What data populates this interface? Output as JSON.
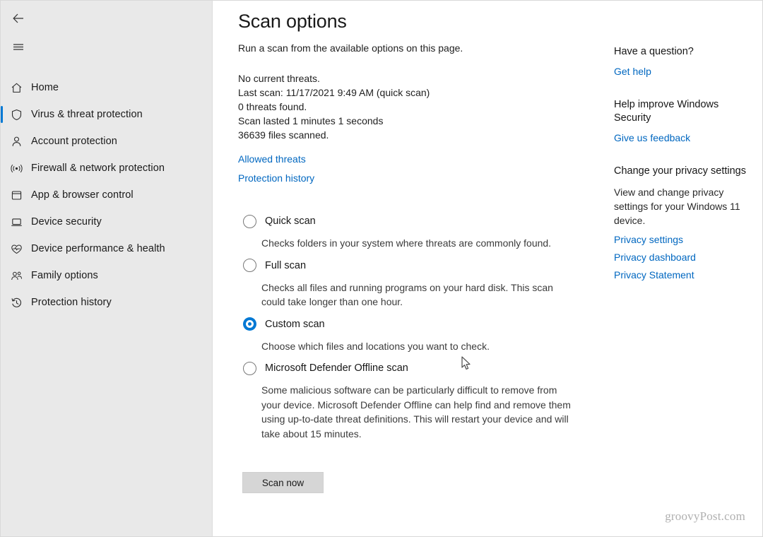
{
  "sidebar": {
    "back_label": "Back",
    "menu_label": "Menu",
    "items": [
      {
        "label": "Home",
        "icon": "home-icon",
        "selected": false
      },
      {
        "label": "Virus & threat protection",
        "icon": "shield-icon",
        "selected": true
      },
      {
        "label": "Account protection",
        "icon": "person-icon",
        "selected": false
      },
      {
        "label": "Firewall & network protection",
        "icon": "wifi-icon",
        "selected": false
      },
      {
        "label": "App & browser control",
        "icon": "app-window-icon",
        "selected": false
      },
      {
        "label": "Device security",
        "icon": "laptop-icon",
        "selected": false
      },
      {
        "label": "Device performance & health",
        "icon": "heart-pulse-icon",
        "selected": false
      },
      {
        "label": "Family options",
        "icon": "people-icon",
        "selected": false
      },
      {
        "label": "Protection history",
        "icon": "history-clock-icon",
        "selected": false
      }
    ]
  },
  "main": {
    "title": "Scan options",
    "subtitle": "Run a scan from the available options on this page.",
    "status_lines": [
      "No current threats.",
      "Last scan: 11/17/2021 9:49 AM (quick scan)",
      "0 threats found.",
      "Scan lasted 1 minutes 1 seconds",
      "36639 files scanned."
    ],
    "status_links": [
      {
        "label": "Allowed threats"
      },
      {
        "label": "Protection history"
      }
    ],
    "options": [
      {
        "label": "Quick scan",
        "selected": false,
        "description": "Checks folders in your system where threats are commonly found."
      },
      {
        "label": "Full scan",
        "selected": false,
        "description": "Checks all files and running programs on your hard disk. This scan could take longer than one hour."
      },
      {
        "label": "Custom scan",
        "selected": true,
        "description": "Choose which files and locations you want to check."
      },
      {
        "label": "Microsoft Defender Offline scan",
        "selected": false,
        "description": "Some malicious software can be particularly difficult to remove from your device. Microsoft Defender Offline can help find and remove them using up-to-date threat definitions. This will restart your device and will take about 15 minutes."
      }
    ],
    "scan_button": "Scan now"
  },
  "right_panel": {
    "sections": [
      {
        "heading": "Have a question?",
        "text": "",
        "links": [
          {
            "label": "Get help"
          }
        ]
      },
      {
        "heading": "Help improve Windows Security",
        "text": "",
        "links": [
          {
            "label": "Give us feedback"
          }
        ]
      },
      {
        "heading": "Change your privacy settings",
        "text": "View and change privacy settings for your Windows 11 device.",
        "links": [
          {
            "label": "Privacy settings"
          },
          {
            "label": "Privacy dashboard"
          },
          {
            "label": "Privacy Statement"
          }
        ]
      }
    ]
  },
  "watermark": "groovyPost.com",
  "colors": {
    "accent": "#0078d4",
    "link": "#0067c0",
    "sidebar_bg": "#e9e9e9",
    "content_bg": "#ffffff",
    "button_bg": "#d6d6d6"
  }
}
